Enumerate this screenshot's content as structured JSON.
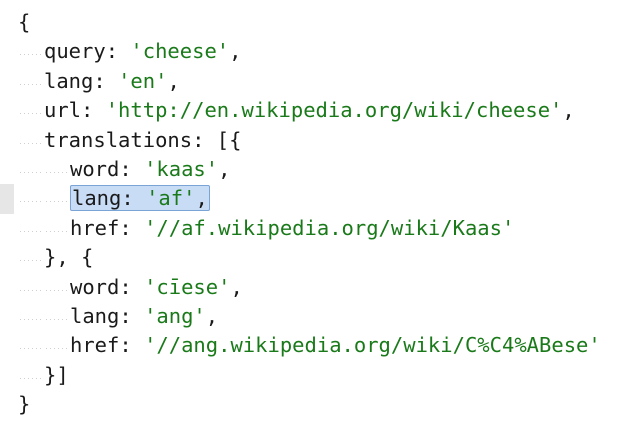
{
  "editor": {
    "lines": {
      "l1": "{",
      "l2_key": "query:",
      "l2_val": "'cheese'",
      "l2_end": ",",
      "l3_key": "lang:",
      "l3_val": "'en'",
      "l3_end": ",",
      "l4_key": "url:",
      "l4_val": "'http://en.wikipedia.org/wiki/cheese'",
      "l4_end": ",",
      "l5_key": "translations:",
      "l5_end": "[{",
      "l6_key": "word:",
      "l6_val": "'kaas'",
      "l6_end": ",",
      "l7_key": "lang:",
      "l7_val": "'af'",
      "l7_end": ",",
      "l8_key": "href:",
      "l8_val": "'//af.wikipedia.org/wiki/Kaas'",
      "l9": "}, {",
      "l10_key": "word:",
      "l10_val": "'cīese'",
      "l10_end": ",",
      "l11_key": "lang:",
      "l11_val": "'ang'",
      "l11_end": ",",
      "l12_key": "href:",
      "l12_val": "'//ang.wikipedia.org/wiki/C%C4%ABese'",
      "l13": "}]",
      "l14": "}"
    },
    "colors": {
      "string": "#1a7a1a",
      "text": "#1a1a1a",
      "selection": "#c9dcf6",
      "current_line_marker": "#e6e6e6"
    }
  }
}
